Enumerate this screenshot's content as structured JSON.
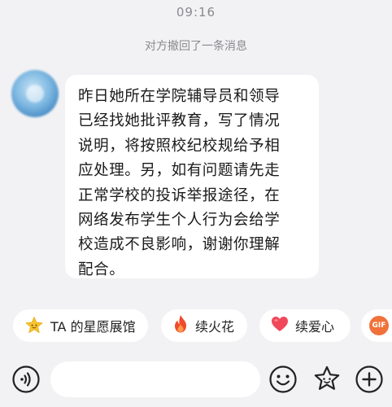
{
  "status_time": "09:16",
  "system_message": "对方撤回了一条消息",
  "message": {
    "lines": [
      "昨日她所在学院辅导员和领导",
      "已经找她批评教育，写了情况",
      "说明，将按照校纪校规给予相",
      "应处理。另，如有问题请先走",
      "正常学校的投诉举报途径，在",
      "网络发布学生个人行为会给学",
      "校造成不良影响，谢谢你理解",
      "配合。"
    ]
  },
  "quick_actions": [
    {
      "label": "TA 的星愿展馆",
      "icon": "star-face-icon"
    },
    {
      "label": "续火花",
      "icon": "fire-icon"
    },
    {
      "label": "续爱心",
      "icon": "heart-icon"
    },
    {
      "label": "GIF",
      "icon": "gif-icon"
    }
  ],
  "input": {
    "value": "",
    "placeholder": ""
  },
  "colors": {
    "background": "#f2f2f4",
    "bubble": "#ffffff",
    "text": "#1a1a1a",
    "muted": "#8a8a8e",
    "fire": "#f04a2a",
    "heart": "#f0485a",
    "star": "#f7c52e",
    "gif": "#f0723a"
  }
}
